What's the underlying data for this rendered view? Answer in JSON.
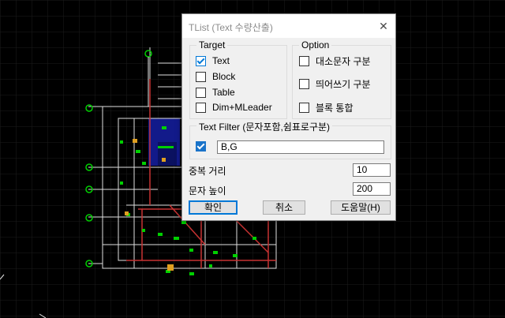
{
  "dialog": {
    "title": "TList (Text 수량산출)",
    "close_glyph": "✕",
    "target": {
      "legend": "Target",
      "items": [
        {
          "label": "Text",
          "checked": true
        },
        {
          "label": "Block",
          "checked": false
        },
        {
          "label": "Table",
          "checked": false
        },
        {
          "label": "Dim+MLeader",
          "checked": false
        }
      ]
    },
    "option": {
      "legend": "Option",
      "items": [
        {
          "label": "대소문자 구분",
          "checked": false
        },
        {
          "label": "띄어쓰기 구분",
          "checked": false
        },
        {
          "label": "블록 통합",
          "checked": false
        }
      ]
    },
    "filter": {
      "legend": "Text Filter (문자포함,쉼표로구분)",
      "checked": true,
      "value": "B,G"
    },
    "dup_distance": {
      "label": "중복 거리",
      "value": "10"
    },
    "text_height": {
      "label": "문자 높이",
      "value": "200"
    },
    "buttons": {
      "ok": "확인",
      "cancel": "취소",
      "help": "도움말(H)"
    }
  },
  "colors": {
    "background": "#000000",
    "cad_white": "#e8e8e8",
    "cad_green": "#00d000",
    "cad_blue": "#1010a0",
    "cad_red": "#c03030",
    "accent": "#0078d7"
  }
}
